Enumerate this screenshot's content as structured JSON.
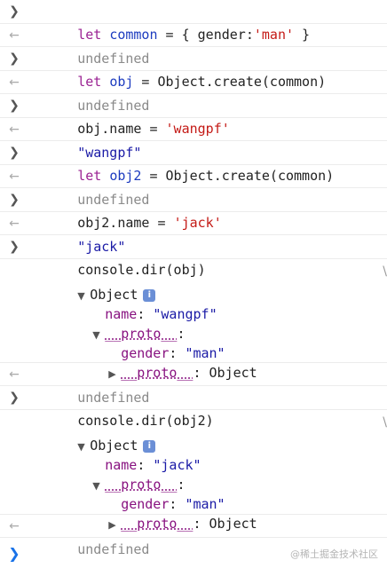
{
  "console": {
    "cmd1": {
      "kw": "let",
      "name": "common",
      "op": " = ",
      "code": "{ gender:",
      "str": "'man'",
      "end": " }"
    },
    "out1": "undefined",
    "cmd2": {
      "kw": "let",
      "name": "obj",
      "op": " = ",
      "code": "Object.create(common)"
    },
    "out2": "undefined",
    "cmd3": {
      "code": "obj.name",
      "op": " = ",
      "str": "'wangpf'"
    },
    "out3": "\"wangpf\"",
    "cmd4": {
      "kw": "let",
      "name": "obj2",
      "op": " = ",
      "code": "Object.create(common)"
    },
    "out4": "undefined",
    "cmd5": {
      "code": "obj2.name",
      "op": " = ",
      "str": "'jack'"
    },
    "out5": "\"jack\"",
    "cmd6": {
      "code": "console.dir(obj)"
    },
    "dir1": {
      "label": "Object",
      "info": "i",
      "name_key": "name",
      "name_val": "\"wangpf\"",
      "proto_key": "__proto__",
      "gender_key": "gender",
      "gender_val": "\"man\"",
      "inner_proto_key": "__proto__",
      "inner_proto_val": "Object"
    },
    "out6": "undefined",
    "cmd7": {
      "code": "console.dir(obj2)"
    },
    "dir2": {
      "label": "Object",
      "info": "i",
      "name_key": "name",
      "name_val": "\"jack\"",
      "proto_key": "__proto__",
      "gender_key": "gender",
      "gender_val": "\"man\"",
      "inner_proto_key": "__proto__",
      "inner_proto_val": "Object"
    },
    "out7": "undefined",
    "edge_mark": "\\"
  },
  "watermark": "@稀土掘金技术社区",
  "icons": {
    "input_prompt": "chevron-right-icon",
    "return_arrow": "return-arrow-icon",
    "expanded": "triangle-down-icon",
    "collapsed": "triangle-right-icon",
    "info": "info-icon"
  }
}
